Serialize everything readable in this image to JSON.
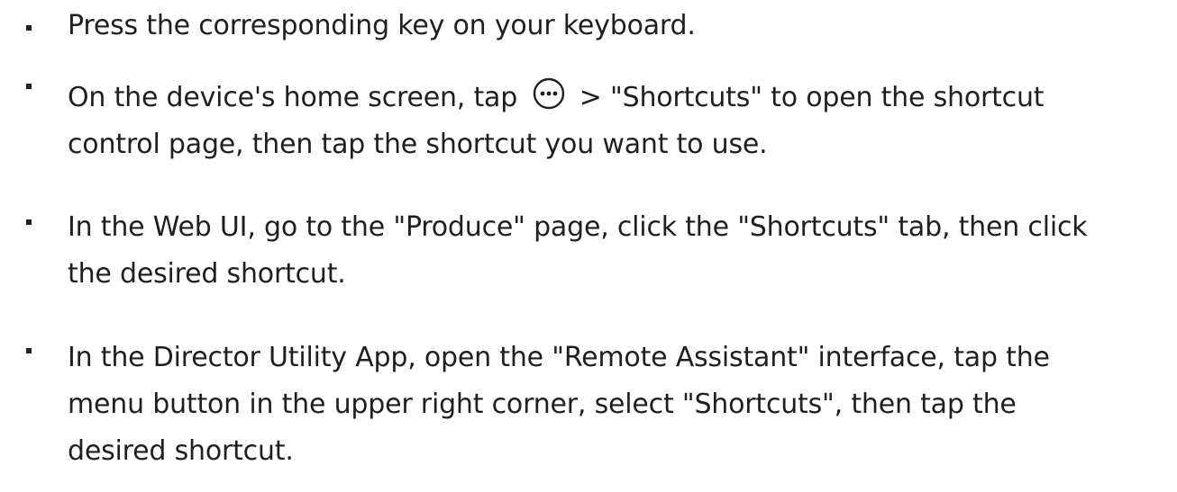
{
  "steps": [
    {
      "lines": [
        "Press the corresponding key on your keyboard."
      ]
    },
    {
      "line1_before_icon": "On the device's home screen, tap",
      "icon": "more-icon",
      "line1_after_icon": "> \"Shortcuts\" to open the shortcut",
      "line2": "control page, then tap the shortcut you want to use."
    },
    {
      "lines": [
        "In the Web UI, go to the \"Produce\" page, click the \"Shortcuts\" tab, then click",
        "the desired shortcut."
      ]
    },
    {
      "lines": [
        "In the Director Utility App, open the \"Remote Assistant\" interface, tap the",
        "menu button in the upper right corner, select \"Shortcuts\", then tap the",
        "desired shortcut."
      ]
    }
  ]
}
